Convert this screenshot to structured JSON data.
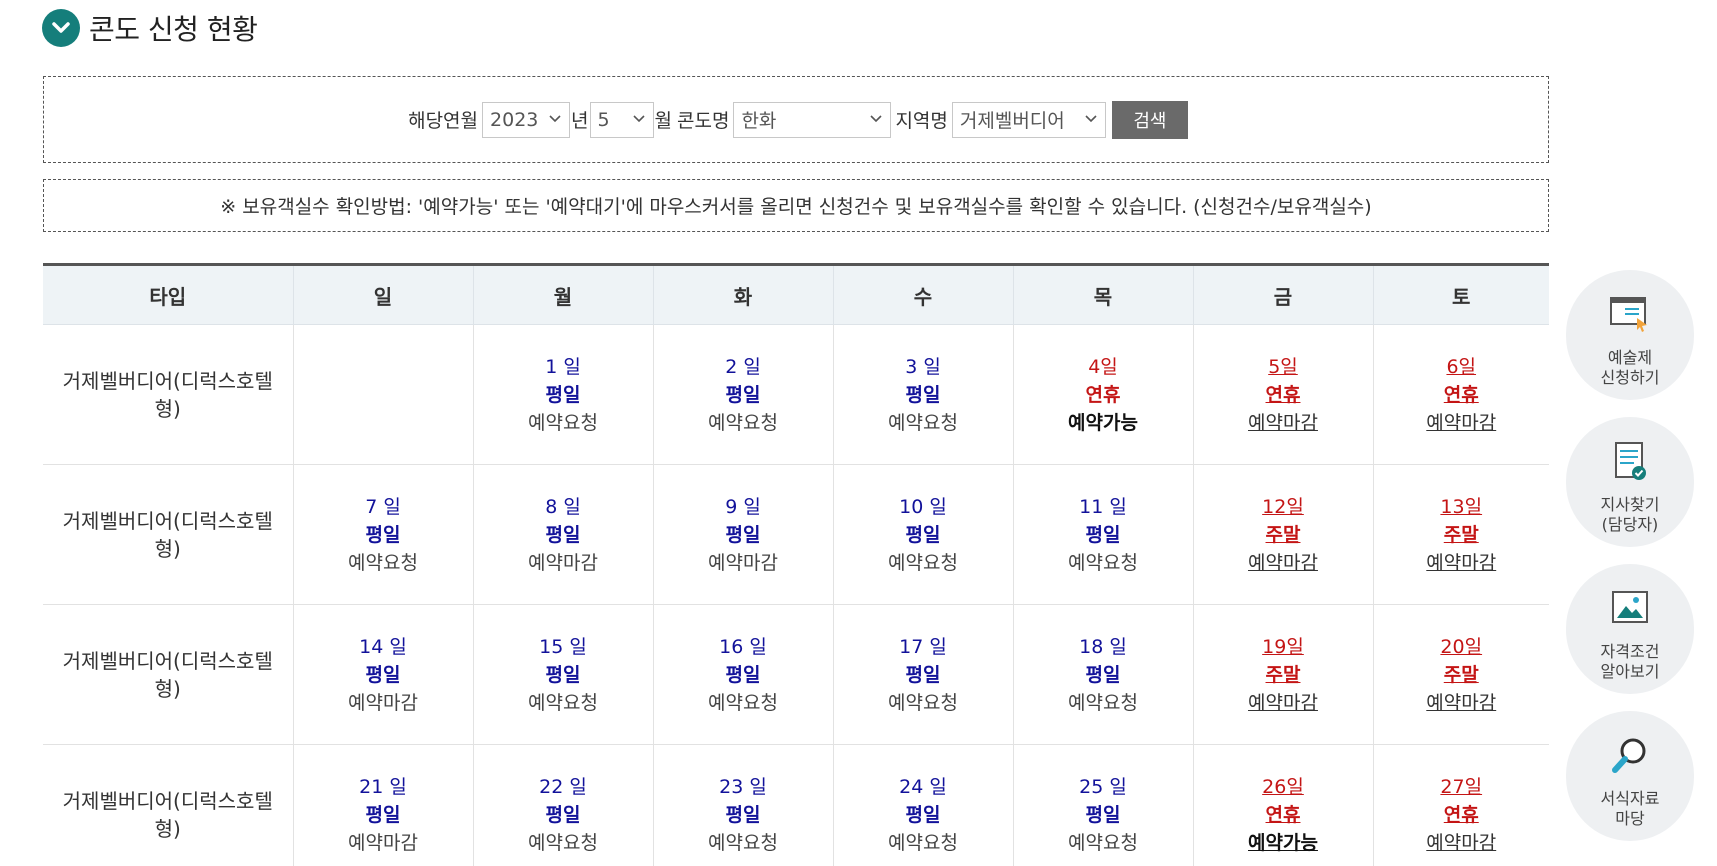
{
  "page": {
    "title": "콘도 신청 현황"
  },
  "search": {
    "label_month": "해당연월",
    "year_value": "2023",
    "year_suffix": "년",
    "month_value": "5",
    "month_suffix": "월",
    "label_condo": "콘도명",
    "condo_value": "한화",
    "label_region": "지역명",
    "region_value": "거제벨버디어",
    "search_button": "검색"
  },
  "notice": "※ 보유객실수 확인방법: '예약가능' 또는 '예약대기'에 마우스커서를 올리면 신청건수 및 보유객실수를 확인할 수 있습니다. (신청건수/보유객실수)",
  "calendar": {
    "headers": [
      "타입",
      "일",
      "월",
      "화",
      "수",
      "목",
      "금",
      "토"
    ],
    "type_label": "거제벨버디어(디럭스호텔형)",
    "weeks": [
      {
        "type": "거제벨버디어(디럭스호텔형)",
        "days": [
          null,
          {
            "date": "1 일",
            "kind": "평일",
            "status": "예약요청"
          },
          {
            "date": "2 일",
            "kind": "평일",
            "status": "예약요청"
          },
          {
            "date": "3 일",
            "kind": "평일",
            "status": "예약요청"
          },
          {
            "date": "4일",
            "kind": "연휴",
            "status": "예약가능"
          },
          {
            "date": "5일",
            "kind": "연휴",
            "status": "예약마감"
          },
          {
            "date": "6일",
            "kind": "연휴",
            "status": "예약마감"
          }
        ]
      },
      {
        "type": "거제벨버디어(디럭스호텔형)",
        "days": [
          {
            "date": "7 일",
            "kind": "평일",
            "status": "예약요청"
          },
          {
            "date": "8 일",
            "kind": "평일",
            "status": "예약마감"
          },
          {
            "date": "9 일",
            "kind": "평일",
            "status": "예약마감"
          },
          {
            "date": "10 일",
            "kind": "평일",
            "status": "예약요청"
          },
          {
            "date": "11 일",
            "kind": "평일",
            "status": "예약요청"
          },
          {
            "date": "12일",
            "kind": "주말",
            "status": "예약마감"
          },
          {
            "date": "13일",
            "kind": "주말",
            "status": "예약마감"
          }
        ]
      },
      {
        "type": "거제벨버디어(디럭스호텔형)",
        "days": [
          {
            "date": "14 일",
            "kind": "평일",
            "status": "예약마감"
          },
          {
            "date": "15 일",
            "kind": "평일",
            "status": "예약요청"
          },
          {
            "date": "16 일",
            "kind": "평일",
            "status": "예약요청"
          },
          {
            "date": "17 일",
            "kind": "평일",
            "status": "예약요청"
          },
          {
            "date": "18 일",
            "kind": "평일",
            "status": "예약요청"
          },
          {
            "date": "19일",
            "kind": "주말",
            "status": "예약마감"
          },
          {
            "date": "20일",
            "kind": "주말",
            "status": "예약마감"
          }
        ]
      },
      {
        "type": "거제벨버디어(디럭스호텔형)",
        "days": [
          {
            "date": "21 일",
            "kind": "평일",
            "status": "예약마감"
          },
          {
            "date": "22 일",
            "kind": "평일",
            "status": "예약요청"
          },
          {
            "date": "23 일",
            "kind": "평일",
            "status": "예약요청"
          },
          {
            "date": "24 일",
            "kind": "평일",
            "status": "예약요청"
          },
          {
            "date": "25 일",
            "kind": "평일",
            "status": "예약요청"
          },
          {
            "date": "26일",
            "kind": "연휴",
            "status": "예약가능"
          },
          {
            "date": "27일",
            "kind": "연휴",
            "status": "예약마감"
          }
        ]
      }
    ]
  },
  "quick_menu": [
    {
      "label": "예술제\n신청하기",
      "icon": "monitor-cursor-icon"
    },
    {
      "label": "지사찾기\n(담당자)",
      "icon": "list-check-icon"
    },
    {
      "label": "자격조건\n알아보기",
      "icon": "picture-icon"
    },
    {
      "label": "서식자료\n마당",
      "icon": "magnifier-icon"
    }
  ],
  "colors": {
    "accent": "#157e7b",
    "weekday": "#12129a",
    "weekend": "#c41515",
    "header_bg": "#eef3f6"
  }
}
